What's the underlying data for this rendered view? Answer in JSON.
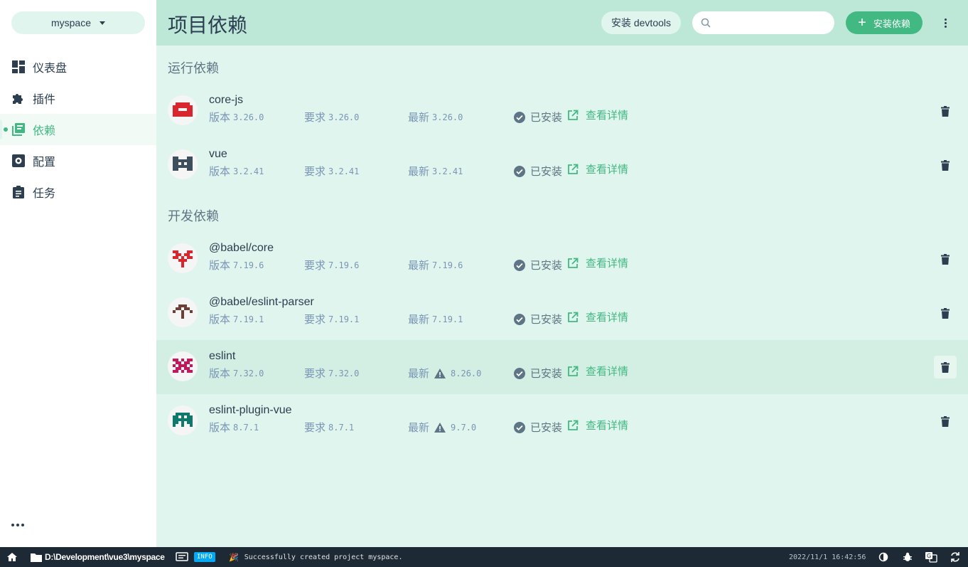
{
  "sidebar": {
    "project_name": "myspace",
    "nav": [
      {
        "label": "仪表盘",
        "icon": "dashboard-icon"
      },
      {
        "label": "插件",
        "icon": "puzzle-icon"
      },
      {
        "label": "依赖",
        "icon": "library-icon",
        "active": true
      },
      {
        "label": "配置",
        "icon": "settings-icon"
      },
      {
        "label": "任务",
        "icon": "clipboard-icon"
      }
    ]
  },
  "header": {
    "title": "项目依赖",
    "devtools_label": "安装 devtools",
    "search_placeholder": "",
    "install_label": "安装依赖"
  },
  "sections": {
    "runtime_title": "运行依赖",
    "dev_title": "开发依赖"
  },
  "labels": {
    "version": "版本",
    "wanted": "要求",
    "latest": "最新",
    "installed": "已安装",
    "details": "查看详情"
  },
  "dependencies": [
    {
      "name": "core-js",
      "version": "3.26.0",
      "wanted": "3.26.0",
      "latest": "3.26.0",
      "outdated": false,
      "color": "#d9262e"
    },
    {
      "name": "vue",
      "version": "3.2.41",
      "wanted": "3.2.41",
      "latest": "3.2.41",
      "outdated": false,
      "color": "#3d4f5c"
    },
    {
      "name": "@babel/core",
      "version": "7.19.6",
      "wanted": "7.19.6",
      "latest": "7.19.6",
      "outdated": false,
      "color": "#d9262e"
    },
    {
      "name": "@babel/eslint-parser",
      "version": "7.19.1",
      "wanted": "7.19.1",
      "latest": "7.19.1",
      "outdated": false,
      "color": "#6d4037"
    },
    {
      "name": "eslint",
      "version": "7.32.0",
      "wanted": "7.32.0",
      "latest": "8.26.0",
      "outdated": true,
      "color": "#c2185b"
    },
    {
      "name": "eslint-plugin-vue",
      "version": "8.7.1",
      "wanted": "8.7.1",
      "latest": "9.7.0",
      "outdated": true,
      "color": "#0f7a6b"
    }
  ],
  "statusbar": {
    "path": "D:\\Development\\vue3\\myspace",
    "log_level": "INFO",
    "log_emoji": "🎉",
    "log_message": "Successfully created project myspace.",
    "timestamp": "2022/11/1  16:42:56"
  },
  "colors": {
    "accent": "#42b983",
    "header_bg": "#bde8d8",
    "content_bg": "#e0f5ed",
    "statusbar_bg": "#1d2935",
    "info_badge": "#03a9f4",
    "muted": "#7a95b5"
  }
}
